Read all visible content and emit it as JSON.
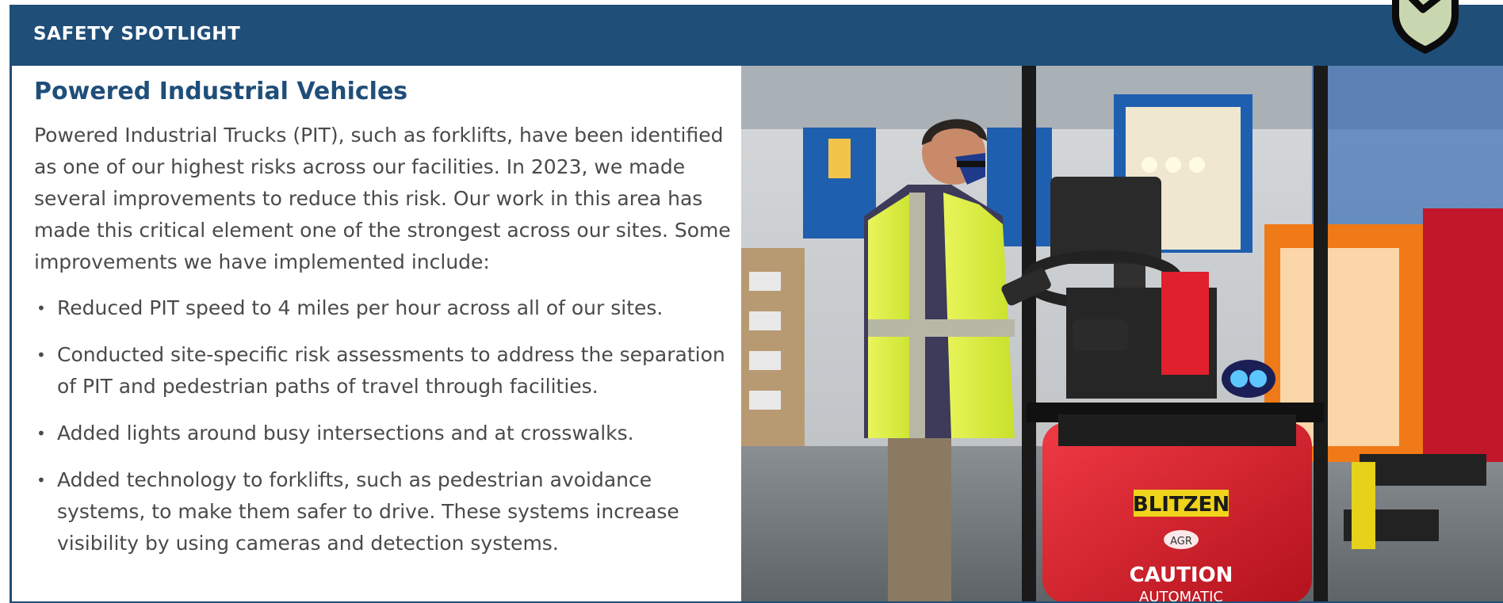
{
  "header": {
    "title": "SAFETY SPOTLIGHT",
    "badge_icon": "shield-check-icon"
  },
  "section": {
    "title": "Powered Industrial Vehicles",
    "intro": "Powered Industrial Trucks (PIT), such as forklifts, have been identified as one of our highest risks across our facilities. In 2023, we made several improvements to reduce this risk. Our work in this area has made this critical element one of the strongest across our sites. Some improvements we have implemented include:",
    "bullets": [
      "Reduced PIT speed to 4 miles per hour across all of our sites.",
      "Conducted site-specific risk assessments to address the separation of PIT and pedestrian paths of travel through facilities.",
      "Added lights around busy intersections and at crosswalks.",
      "Added technology to forklifts, such as pedestrian avoidance systems, to make them safer to drive. These systems increase visibility by using cameras and detection systems."
    ]
  },
  "photo": {
    "brand_label": "BLITZEN",
    "logo_label": "AGR",
    "caution_label": "CAUTION",
    "sub_label": "AUTOMATIC"
  },
  "colors": {
    "brand_navy": "#1f4e79",
    "body_text": "#4a4a4a",
    "vest_yellow": "#d9f03a",
    "forklift_red": "#e0202c"
  }
}
